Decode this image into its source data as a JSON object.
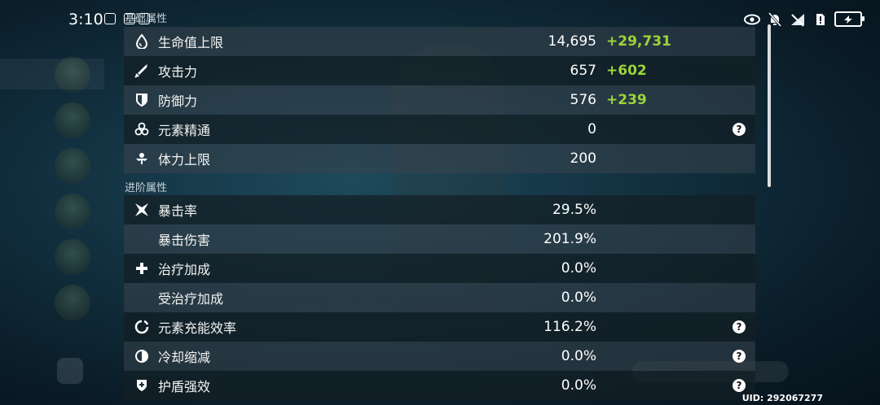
{
  "status_bar": {
    "time": "3:10"
  },
  "sections": {
    "base": "基础属性",
    "advanced": "进阶属性"
  },
  "base_stats": [
    {
      "icon": "droplet-icon",
      "name": "生命值上限",
      "value": "14,695",
      "bonus": "+29,731",
      "help": false
    },
    {
      "icon": "sword-icon",
      "name": "攻击力",
      "value": "657",
      "bonus": "+602",
      "help": false
    },
    {
      "icon": "shield-icon",
      "name": "防御力",
      "value": "576",
      "bonus": "+239",
      "help": false
    },
    {
      "icon": "element-icon",
      "name": "元素精通",
      "value": "0",
      "bonus": "",
      "help": true
    },
    {
      "icon": "stamina-icon",
      "name": "体力上限",
      "value": "200",
      "bonus": "",
      "help": false
    }
  ],
  "advanced_stats": [
    {
      "icon": "crit-icon",
      "name": "暴击率",
      "value": "29.5%",
      "help": false
    },
    {
      "icon": "",
      "name": "暴击伤害",
      "value": "201.9%",
      "help": false
    },
    {
      "icon": "plus-icon",
      "name": "治疗加成",
      "value": "0.0%",
      "help": false
    },
    {
      "icon": "",
      "name": "受治疗加成",
      "value": "0.0%",
      "help": false
    },
    {
      "icon": "energy-icon",
      "name": "元素充能效率",
      "value": "116.2%",
      "help": true
    },
    {
      "icon": "cooldown-icon",
      "name": "冷却缩减",
      "value": "0.0%",
      "help": true
    },
    {
      "icon": "shield-plus-icon",
      "name": "护盾强效",
      "value": "0.0%",
      "help": true
    }
  ],
  "uid": "UID: 292067277",
  "colors": {
    "bonus": "#9bd43a"
  }
}
